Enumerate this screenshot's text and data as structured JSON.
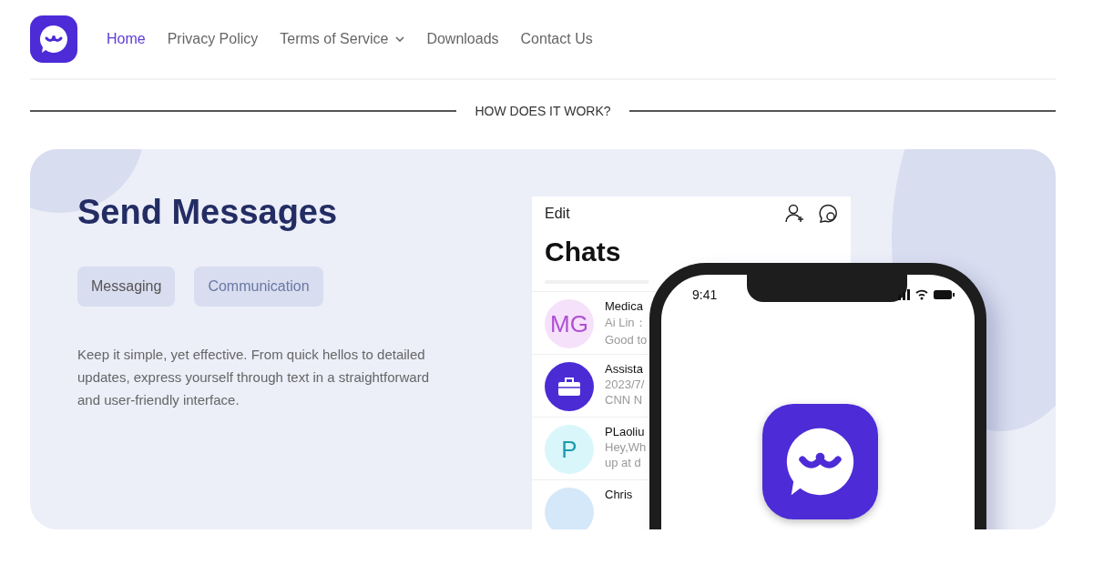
{
  "nav": {
    "items": [
      {
        "label": "Home",
        "selected": true,
        "has_dropdown": false
      },
      {
        "label": "Privacy Policy",
        "selected": false,
        "has_dropdown": false
      },
      {
        "label": "Terms of Service",
        "selected": false,
        "has_dropdown": true
      },
      {
        "label": "Downloads",
        "selected": false,
        "has_dropdown": false
      },
      {
        "label": "Contact Us",
        "selected": false,
        "has_dropdown": false
      }
    ]
  },
  "section_heading": "HOW DOES IT WORK?",
  "feature": {
    "title": "Send Messages",
    "tags": [
      "Messaging",
      "Communication"
    ],
    "text": "Keep it simple, yet effective. From quick hellos to detailed updates, express yourself through text in a straightforward and user-friendly interface."
  },
  "preview": {
    "chat_screen": {
      "edit": "Edit",
      "title": "Chats",
      "chats": [
        {
          "kind": "initials",
          "avatar": "MG",
          "color": "#f6e1fb",
          "name": "Medica",
          "lines": [
            "Ai Lin：",
            "Good to"
          ]
        },
        {
          "kind": "icon",
          "color": "#4b2bd4",
          "name": "Assista",
          "lines": [
            "2023/7/",
            "CNN N"
          ]
        },
        {
          "kind": "initials",
          "avatar": "P",
          "color": "#d9f6fb",
          "name": "PLaoliu",
          "lines": [
            "Hey,Wh",
            "up at d"
          ]
        },
        {
          "kind": "blank",
          "color": "#d5e8fa",
          "name": "Chris"
        }
      ]
    },
    "phone": {
      "time": "9:41"
    }
  }
}
